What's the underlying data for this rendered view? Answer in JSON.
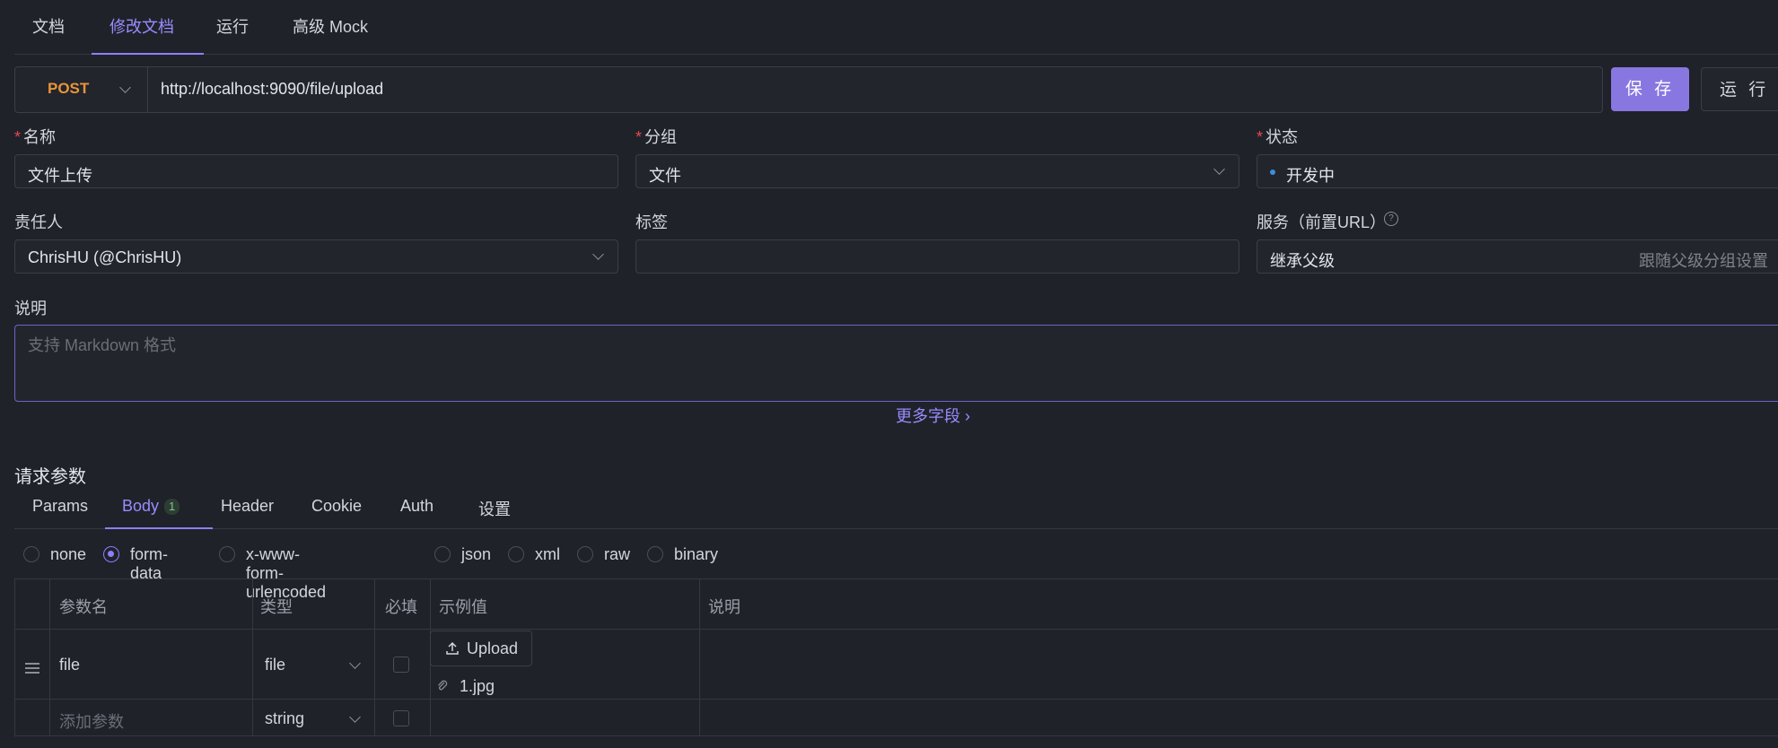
{
  "top_tabs": [
    "文档",
    "修改文档",
    "运行",
    "高级 Mock"
  ],
  "active_top_tab": "修改文档",
  "request": {
    "method": "POST",
    "url": "http://localhost:9090/file/upload",
    "save_label": "保 存",
    "run_label": "运 行"
  },
  "colors": {
    "accent": "#8877e0",
    "method_post": "#e8943a",
    "required": "#e5484d",
    "status_dot": "#3d8de0"
  },
  "form": {
    "name_label": "名称",
    "name_value": "文件上传",
    "group_label": "分组",
    "group_value": "文件",
    "status_label": "状态",
    "status_value": "开发中",
    "owner_label": "责任人",
    "owner_value": "ChrisHU (@ChrisHU)",
    "tags_label": "标签",
    "service_label": "服务（前置URL）",
    "service_value": "继承父级",
    "service_hint": "跟随父级分组设置（",
    "desc_label": "说明",
    "desc_placeholder": "支持 Markdown 格式",
    "more_fields": "更多字段 ›"
  },
  "params": {
    "title": "请求参数",
    "tabs": [
      {
        "label": "Params"
      },
      {
        "label": "Body",
        "badge": "1"
      },
      {
        "label": "Header"
      },
      {
        "label": "Cookie"
      },
      {
        "label": "Auth"
      },
      {
        "label": "设置"
      }
    ],
    "body_types": [
      "none",
      "form-data",
      "x-www-form-urlencoded",
      "json",
      "xml",
      "raw",
      "binary"
    ],
    "selected_body_type": "form-data",
    "columns": [
      "参数名",
      "类型",
      "必填",
      "示例值",
      "说明"
    ],
    "rows": [
      {
        "name": "file",
        "type": "file",
        "required": false,
        "upload_label": "Upload",
        "file_name": "1.jpg"
      }
    ],
    "add_row": {
      "name_placeholder": "添加参数",
      "type": "string"
    }
  }
}
